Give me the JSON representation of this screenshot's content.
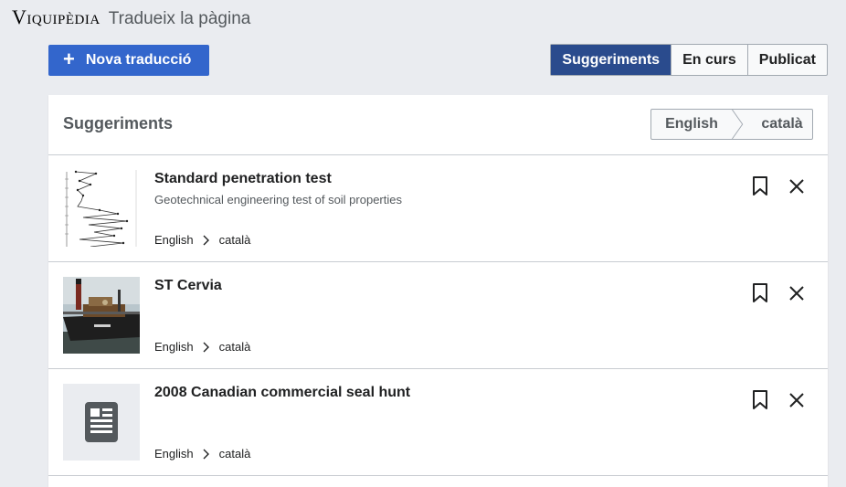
{
  "header": {
    "logo_text": "Viquipèdia",
    "title": "Tradueix la pàgina"
  },
  "toolbar": {
    "new_translation_label": "Nova traducció",
    "tabs": [
      {
        "label": "Suggeriments",
        "active": true
      },
      {
        "label": "En curs",
        "active": false
      },
      {
        "label": "Publicat",
        "active": false
      }
    ]
  },
  "panel": {
    "title": "Suggeriments",
    "source_lang": "English",
    "target_lang": "català"
  },
  "suggestions": [
    {
      "title": "Standard penetration test",
      "description": "Geotechnical engineering test of soil properties",
      "source_lang": "English",
      "target_lang": "català",
      "thumb": "chart-thumbnail"
    },
    {
      "title": "ST Cervia",
      "description": "",
      "source_lang": "English",
      "target_lang": "català",
      "thumb": "ship-photo"
    },
    {
      "title": "2008 Canadian commercial seal hunt",
      "description": "",
      "source_lang": "English",
      "target_lang": "català",
      "thumb": "article-placeholder-icon"
    }
  ],
  "colors": {
    "accent": "#3366cc",
    "active_tab": "#2a4b8d",
    "background": "#eaecf0"
  }
}
